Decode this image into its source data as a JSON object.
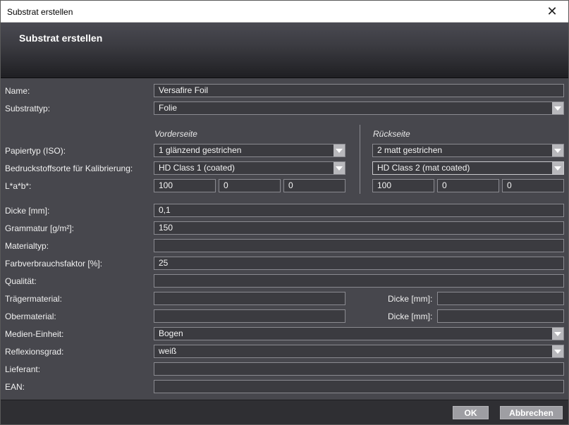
{
  "window": {
    "title": "Substrat erstellen",
    "close_symbol": "✕"
  },
  "header": {
    "title": "Substrat erstellen"
  },
  "form": {
    "name": {
      "label": "Name:",
      "value": "Versafire Foil"
    },
    "substrattyp": {
      "label": "Substrattyp:",
      "value": "Folie"
    },
    "columns": {
      "front": "Vorderseite",
      "back": "Rückseite"
    },
    "papiertyp": {
      "label": "Papiertyp (ISO):",
      "front": "1 glänzend gestrichen",
      "back": "2 matt gestrichen"
    },
    "bedruckstoff": {
      "label": "Bedruckstoffsorte für Kalibrierung:",
      "front": "HD Class 1 (coated)",
      "back": "HD Class 2 (mat coated)"
    },
    "lab": {
      "label": "L*a*b*:",
      "front": [
        "100",
        "0",
        "0"
      ],
      "back": [
        "100",
        "0",
        "0"
      ]
    },
    "dicke": {
      "label": "Dicke [mm]:",
      "value": "0,1"
    },
    "grammatur": {
      "label": "Grammatur [g/m²]:",
      "value": "150"
    },
    "materialtyp": {
      "label": "Materialtyp:",
      "value": ""
    },
    "farbverbrauch": {
      "label": "Farbverbrauchsfaktor [%]:",
      "value": "25"
    },
    "qualitaet": {
      "label": "Qualität:",
      "value": ""
    },
    "traeger": {
      "label": "Trägermaterial:",
      "value": "",
      "dicke_label": "Dicke [mm]:",
      "dicke_value": ""
    },
    "ober": {
      "label": "Obermaterial:",
      "value": "",
      "dicke_label": "Dicke [mm]:",
      "dicke_value": ""
    },
    "medien": {
      "label": "Medien-Einheit:",
      "value": "Bogen"
    },
    "reflexion": {
      "label": "Reflexionsgrad:",
      "value": "weiß"
    },
    "lieferant": {
      "label": "Lieferant:",
      "value": ""
    },
    "ean": {
      "label": "EAN:",
      "value": ""
    }
  },
  "footer": {
    "ok": "OK",
    "cancel": "Abbrechen"
  }
}
